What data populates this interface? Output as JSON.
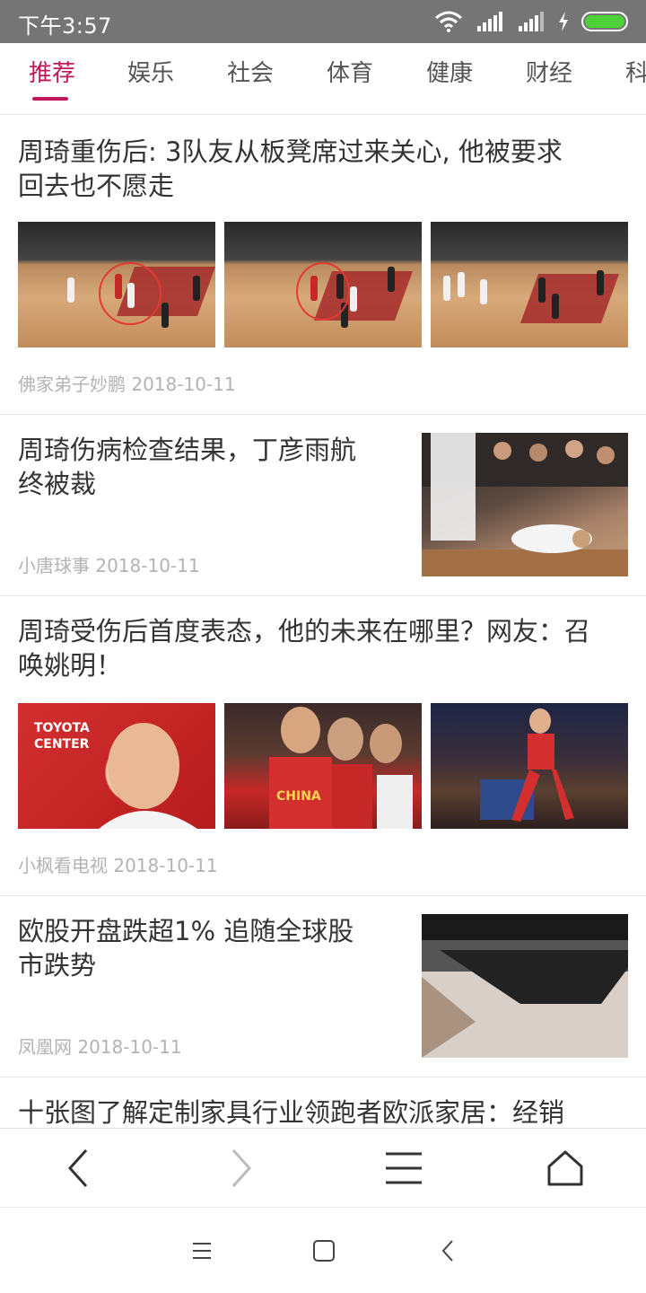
{
  "status_bar": {
    "time": "下午3:57",
    "icons": [
      "wifi-icon",
      "signal-icon",
      "signal-icon",
      "charging-icon",
      "battery-icon"
    ],
    "battery_color": "#4cd137"
  },
  "tabs": [
    {
      "label": "推荐",
      "active": true
    },
    {
      "label": "娱乐",
      "active": false
    },
    {
      "label": "社会",
      "active": false
    },
    {
      "label": "体育",
      "active": false
    },
    {
      "label": "健康",
      "active": false
    },
    {
      "label": "财经",
      "active": false
    },
    {
      "label": "科",
      "active": false
    }
  ],
  "accent_color": "#c2185b",
  "articles": [
    {
      "title_line1": "周琦重伤后: 3队友从板凳席过来关心, 他被要求",
      "title_line2": "回去也不愿走",
      "source": "佛家弟子妙鹏",
      "date": "2018-10-11"
    },
    {
      "title_line1": "周琦伤病检查结果，丁彦雨航",
      "title_line2": "终被裁",
      "source": "小唐球事",
      "date": "2018-10-11"
    },
    {
      "title_line1": "周琦受伤后首度表态，他的未来在哪里？网友：召",
      "title_line2": "唤姚明！",
      "source": "小枫看电视",
      "date": "2018-10-11"
    },
    {
      "title_line1": "欧股开盘跌超1% 追随全球股",
      "title_line2": "市跌势",
      "source": "凤凰网",
      "date": "2018-10-11"
    },
    {
      "title_line1": "十张图了解定制家具行业领跑者欧派家居：经销"
    }
  ],
  "image_text": {
    "toyota": "TOYOTA",
    "center": "CENTER",
    "china": "CHINA"
  },
  "toolbar": {
    "items": [
      "back-icon",
      "forward-icon",
      "menu-icon",
      "home-icon"
    ]
  },
  "system_nav": {
    "items": [
      "recent-apps-icon",
      "home-square-icon",
      "system-back-icon"
    ]
  }
}
